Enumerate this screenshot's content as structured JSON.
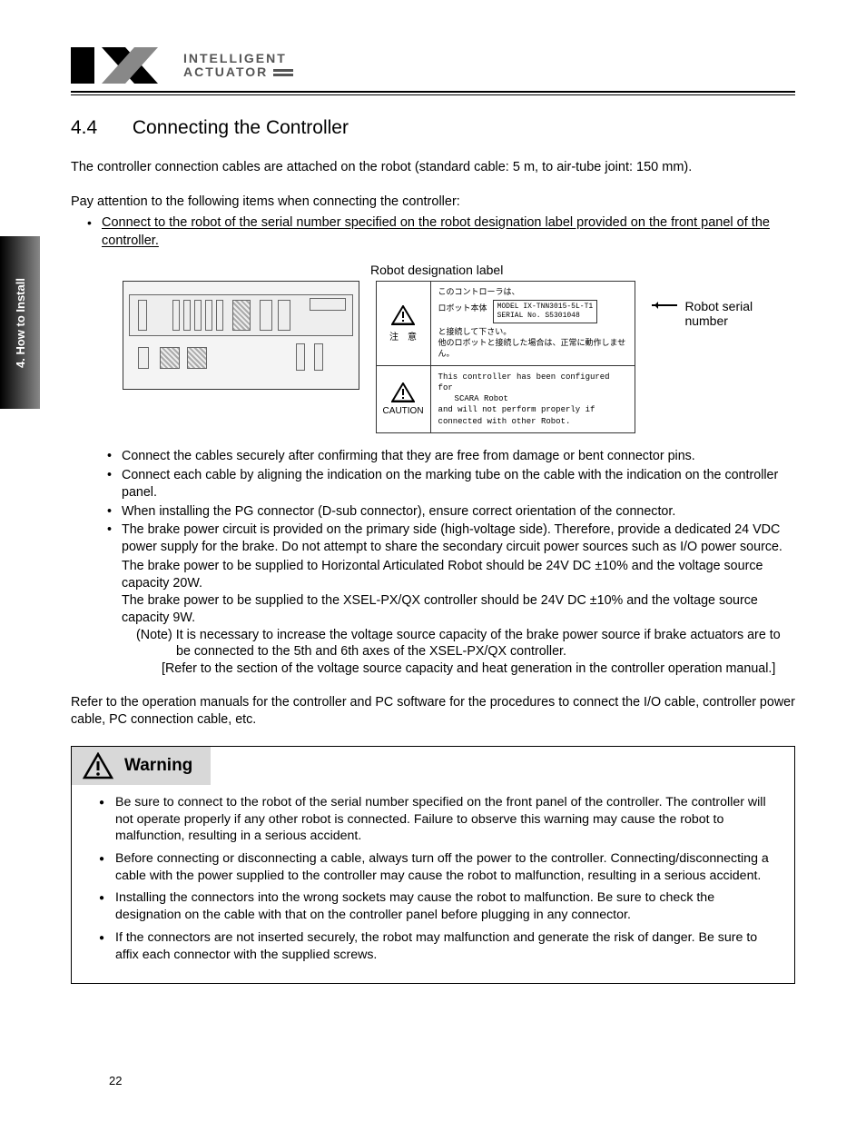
{
  "sidebar": {
    "label": "4. How to Install"
  },
  "logo": {
    "line1": "INTELLIGENT",
    "line2": "ACTUATOR"
  },
  "section": {
    "number": "4.4",
    "title": "Connecting the Controller"
  },
  "intro1": "The controller connection cables are attached on the robot (standard cable: 5 m, to air-tube joint: 150 mm).",
  "intro2": "Pay attention to the following items when connecting the controller:",
  "topBullet": "Connect to the robot of the serial number specified on the robot designation label provided on the front panel of the controller.",
  "figure": {
    "caption": "Robot designation label",
    "serialLabel": "Robot serial number",
    "jp": {
      "caution": "注　意",
      "line1": "このコントローラは、",
      "line2a": "ロボット本体",
      "model": "MODEL  IX-TNN3015-5L-T1",
      "serial": "SERIAL No. S5301048",
      "line3": "と接続して下さい。",
      "line4": "他のロボットと接続した場合は、正常に動作しません。"
    },
    "en": {
      "caution": "CAUTION",
      "line1": "This controller has been configured for",
      "line2": "SCARA Robot",
      "line3": "and will not perform properly if connected with other Robot."
    }
  },
  "bullets": [
    "Connect the cables securely after confirming that they are free from damage or bent connector pins.",
    "Connect each cable by aligning the indication on the marking tube on the cable with the indication on the controller panel.",
    "When installing the PG connector (D-sub connector), ensure correct orientation of the connector.",
    "The brake power circuit is provided on the primary side (high-voltage side). Therefore, provide a dedicated 24 VDC power supply for the brake. Do not attempt to share the secondary circuit power sources such as I/O power source."
  ],
  "bulletsCont": [
    "The brake power to be supplied to Horizontal Articulated Robot should be 24V DC ±10% and the voltage source capacity 20W.",
    "The brake power to be supplied to the XSEL-PX/QX controller should be 24V DC ±10% and the voltage source capacity 9W."
  ],
  "note": {
    "head": "(Note)",
    "l1": "It is necessary to increase the voltage source capacity of the brake power source if brake actuators are to be connected to the 5th and 6th axes of the XSEL-PX/QX controller.",
    "l2": "[Refer to the section of the voltage source capacity and heat generation in the controller operation manual.]"
  },
  "refer": "Refer to the operation manuals for the controller and PC software for the procedures to connect the I/O cable, controller power cable, PC connection cable, etc.",
  "warning": {
    "title": "Warning",
    "items": [
      "Be sure to connect to the robot of the serial number specified on the front panel of the controller. The controller will not operate properly if any other robot is connected. Failure to observe this warning may cause the robot to malfunction, resulting in a serious accident.",
      "Before connecting or disconnecting a cable, always turn off the power to the controller. Connecting/disconnecting a cable with the power supplied to the controller may cause the robot to malfunction, resulting in a serious accident.",
      "Installing the connectors into the wrong sockets may cause the robot to malfunction. Be sure to check the designation on the cable with that on the controller panel before plugging in any connector.",
      "If the connectors are not inserted securely, the robot may malfunction and generate the risk of danger. Be sure to affix each connector with the supplied screws."
    ]
  },
  "pageNumber": "22"
}
